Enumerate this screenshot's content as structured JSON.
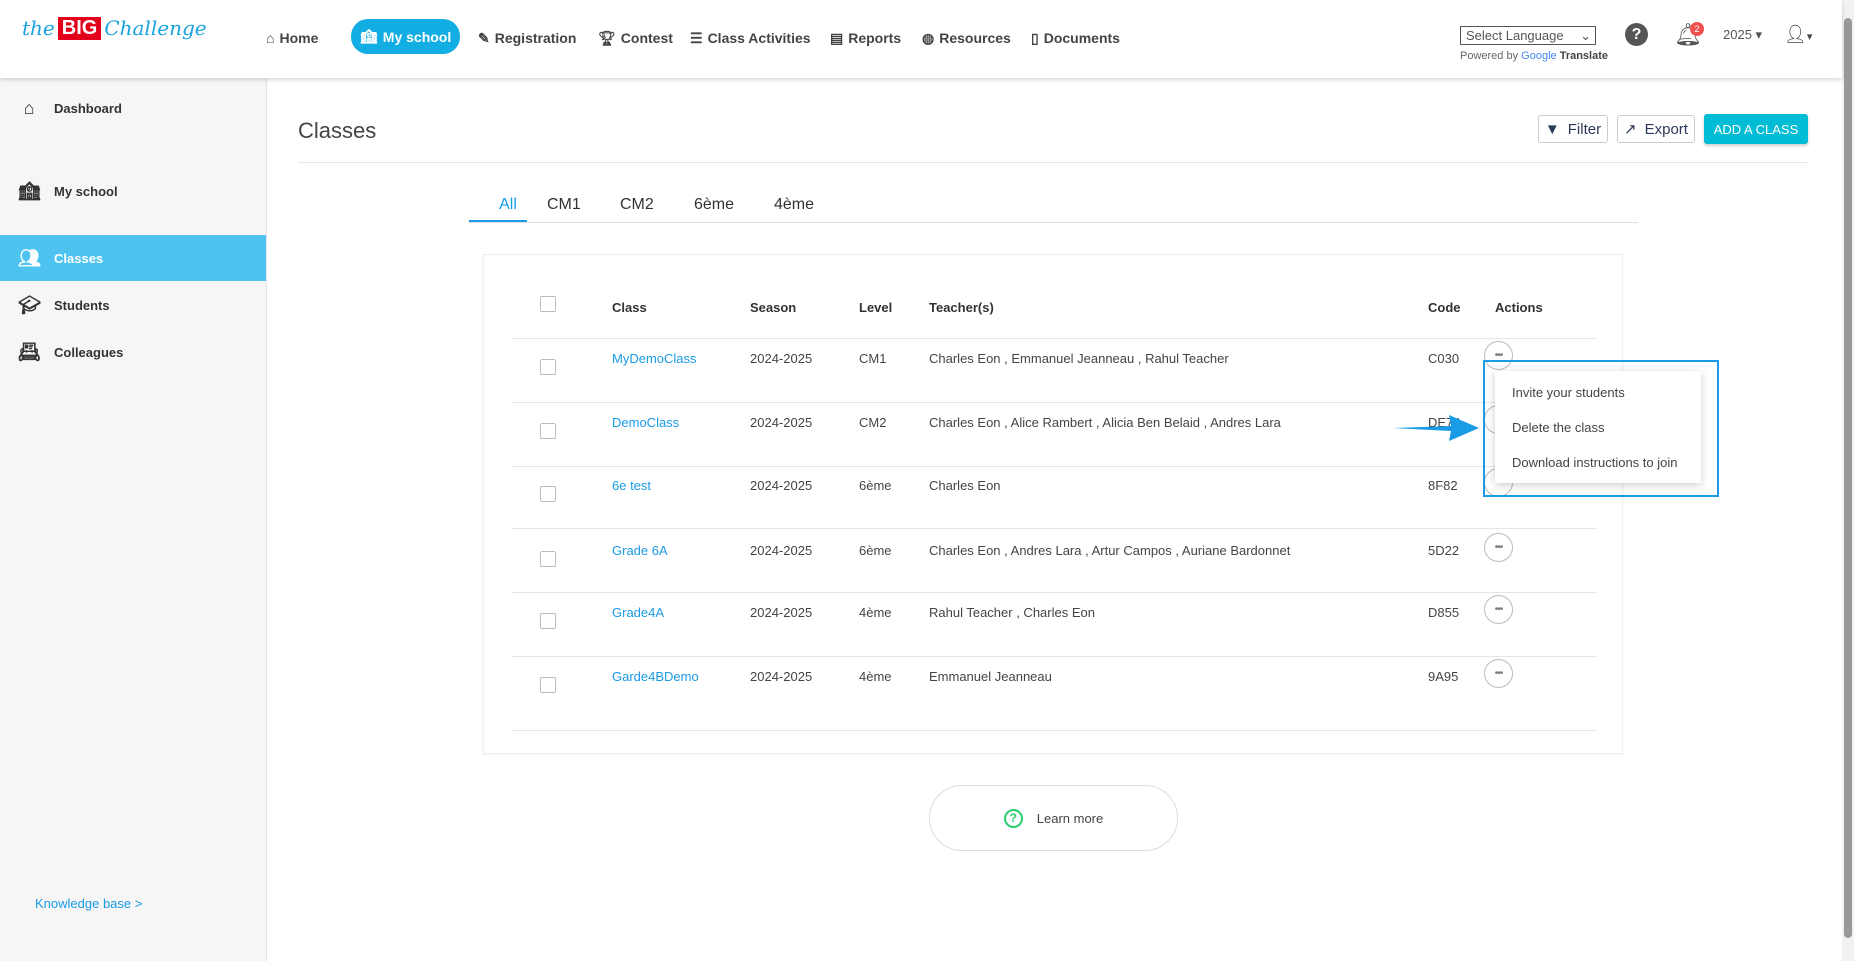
{
  "header": {
    "logo": "the BIG Challenge",
    "nav": [
      {
        "label": "Home",
        "icon": "home-icon"
      },
      {
        "label": "My school",
        "icon": "school-icon"
      },
      {
        "label": "Registration",
        "icon": "edit-icon"
      },
      {
        "label": "Contest",
        "icon": "trophy-icon"
      },
      {
        "label": "Class Activities",
        "icon": "list-icon"
      },
      {
        "label": "Reports",
        "icon": "file-icon"
      },
      {
        "label": "Resources",
        "icon": "globe-icon"
      },
      {
        "label": "Documents",
        "icon": "pdf-icon"
      }
    ],
    "language_select": "Select Language",
    "powered_by": "Powered by",
    "google": "Google",
    "translate": "Translate",
    "notification_count": "2",
    "year": "2025"
  },
  "sidebar": {
    "items": [
      {
        "label": "Dashboard"
      },
      {
        "label": "My school"
      },
      {
        "label": "Classes"
      },
      {
        "label": "Students"
      },
      {
        "label": "Colleagues"
      }
    ],
    "knowledge_base": "Knowledge base >"
  },
  "main": {
    "title": "Classes",
    "filter": "Filter",
    "export": "Export",
    "add_class": "ADD A CLASS",
    "tabs": [
      "All",
      "CM1",
      "CM2",
      "6ème",
      "4ème"
    ],
    "columns": [
      "Class",
      "Season",
      "Level",
      "Teacher(s)",
      "Code",
      "Actions"
    ],
    "rows": [
      [
        "MyDemoClass",
        "2024-2025",
        "CM1",
        "Charles Eon , Emmanuel Jeanneau , Rahul Teacher",
        "C030"
      ],
      [
        "DemoClass",
        "2024-2025",
        "CM2",
        "Charles Eon , Alice Rambert , Alicia Ben Belaid , Andres Lara",
        "DE74"
      ],
      [
        "6e test",
        "2024-2025",
        "6ème",
        "Charles Eon",
        "8F82"
      ],
      [
        "Grade 6A",
        "2024-2025",
        "6ème",
        "Charles Eon , Andres Lara , Artur Campos , Auriane Bardonnet",
        "5D22"
      ],
      [
        "Grade4A",
        "2024-2025",
        "4ème",
        "Rahul Teacher , Charles Eon",
        "D855"
      ],
      [
        "Garde4BDemo",
        "2024-2025",
        "4ème",
        "Emmanuel Jeanneau",
        "9A95"
      ]
    ],
    "actions_menu": [
      "Invite your students",
      "Delete the class",
      "Download instructions to join"
    ],
    "learn_more": "Learn more"
  },
  "colors": {
    "accent": "#12ade2",
    "active_sidebar": "#4fc3f0",
    "add_button": "#00bcd4",
    "highlight": "#1a9be6"
  }
}
